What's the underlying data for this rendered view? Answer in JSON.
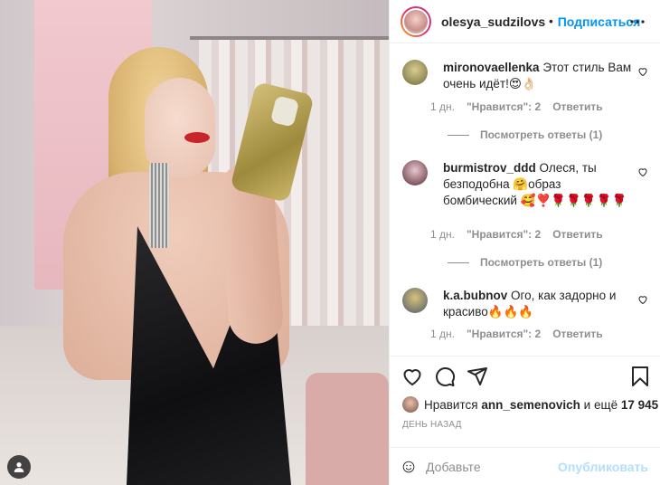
{
  "post": {
    "username": "olesya_sudzilovs",
    "follow_label": "Подписаться",
    "separator": "•"
  },
  "comments": [
    {
      "user": "mironovaellenka",
      "text": "Этот стиль Вам очень идёт!😍👌🏻",
      "age": "1 дн.",
      "likes": "\"Нравится\": 2",
      "reply": "Ответить",
      "view_replies": "Посмотреть ответы (1)",
      "avatar_color": "#b5a36a"
    },
    {
      "user": "burmistrov_ddd",
      "text": "Олеся, ты безподобна 🤗образ бомбический 🥰❣️🌹🌹🌹🌹🌹",
      "age": "1 дн.",
      "likes": "\"Нравится\": 2",
      "reply": "Ответить",
      "view_replies": "Посмотреть ответы (1)",
      "avatar_color": "#7a3a4a"
    },
    {
      "user": "k.a.bubnov",
      "text": "Ого, как задорно и красиво🔥🔥🔥",
      "age": "1 дн.",
      "likes": "\"Нравится\": 2",
      "reply": "Ответить",
      "avatar_color": "#8f7a3e"
    }
  ],
  "likes_line": {
    "prefix": "Нравится",
    "user": "ann_semenovich",
    "middle": "и ещё",
    "count": "17 945"
  },
  "date_label": "ДЕНЬ НАЗАД",
  "composer": {
    "placeholder": "Добавьте",
    "post_label": "Опубликовать"
  },
  "icons": [
    "user-tag-icon",
    "more-icon",
    "heart-icon",
    "comment-icon",
    "share-icon",
    "bookmark-icon",
    "emoji-icon"
  ],
  "colors": {
    "accent": "#0095f6",
    "post_disabled": "#b2dffc",
    "muted": "#8e8e8e",
    "text": "#262626"
  }
}
